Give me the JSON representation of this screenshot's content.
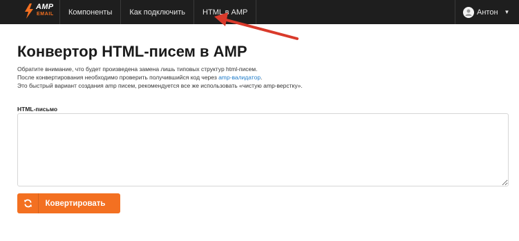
{
  "brand": {
    "top": "AMP",
    "bottom": "EMAIL",
    "accent_color": "#f37021"
  },
  "nav": {
    "items": [
      {
        "label": "Компоненты"
      },
      {
        "label": "Как подключить"
      },
      {
        "label": "HTML в AMP"
      }
    ]
  },
  "user": {
    "name": "Антон",
    "icon": "avatar-icon"
  },
  "page": {
    "title": "Конвертор HTML-писем в AMP",
    "line1": "Обратите внимание, что будет произведена замена лишь типовых структур html-писем.",
    "line2_prefix": "После конвертирования необходимо проверить получившийся код через ",
    "line2_link": "amp-валидатор",
    "line2_suffix": ".",
    "line3": "Это быстрый вариант создания amp писем, рекомендуется все же использовать «чистую amp-верстку»."
  },
  "form": {
    "label": "HTML-письмо",
    "value": "",
    "button_label": "Ковертировать",
    "button_icon": "refresh-icon"
  }
}
